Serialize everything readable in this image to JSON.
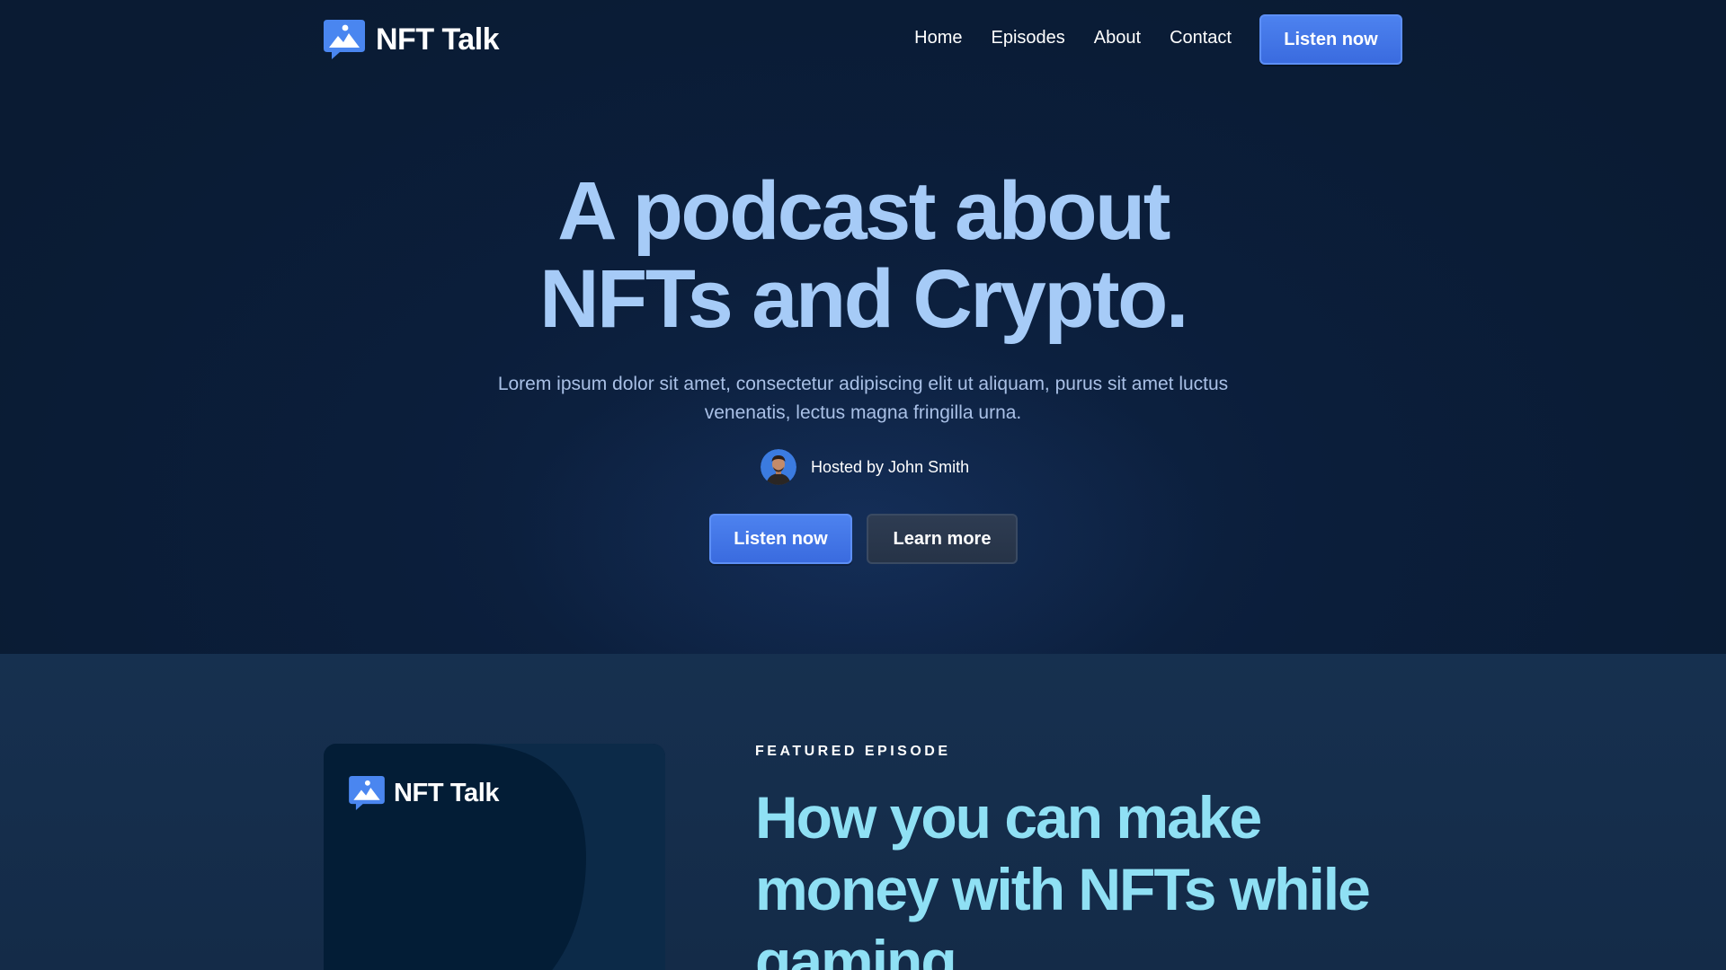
{
  "header": {
    "brand": "NFT Talk",
    "logo_icon": "chat-image-icon",
    "nav": [
      "Home",
      "Episodes",
      "About",
      "Contact"
    ],
    "cta_label": "Listen now"
  },
  "hero": {
    "headline_line1": "A podcast about",
    "headline_line2": "NFTs and Crypto.",
    "subtitle": "Lorem ipsum dolor sit amet, consectetur adipiscing elit ut aliquam, purus sit amet luctus venenatis, lectus magna fringilla urna.",
    "host_text": "Hosted by John Smith",
    "listen_label": "Listen now",
    "learn_label": "Learn more"
  },
  "featured": {
    "eyebrow": "FEATURED EPISODE",
    "title": "How you can make money with NFTs while gaming",
    "cover_brand": "NFT Talk"
  },
  "colors": {
    "accent": "#3f71e6",
    "headline": "#a6cbf7",
    "episode_title": "#8fe0f4",
    "background": "#0b1e3b"
  }
}
